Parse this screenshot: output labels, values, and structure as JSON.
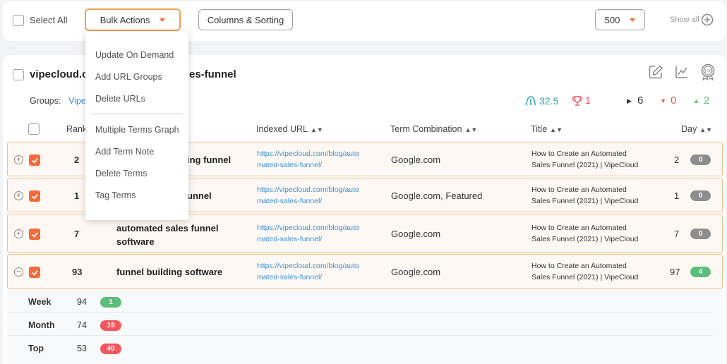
{
  "toolbar": {
    "select_all": "Select All",
    "bulk_actions": "Bulk Actions",
    "columns_sorting": "Columns & Sorting",
    "page_size": "500",
    "show_all": "Show all"
  },
  "menu": {
    "items": [
      "Update On Demand",
      "Add URL Groups",
      "Delete URLs",
      "Multiple Terms Graph",
      "Add Term Note",
      "Delete Terms",
      "Tag Terms"
    ]
  },
  "site": {
    "name_left": "vipecloud.co",
    "name_right": "es-funnel",
    "groups_label": "Groups:",
    "groups_value": "Vipe"
  },
  "stats": {
    "avg": "32.5",
    "trophy": "1",
    "neutral": "6",
    "down": "0",
    "up": "2"
  },
  "headers": {
    "rank": "Rank",
    "indexed_url": "Indexed URL",
    "term_combination": "Term Combination",
    "title": "Title",
    "day": "Day"
  },
  "rows": [
    {
      "rank": "2",
      "term": "ing funnel",
      "url1": "https://vipecloud.com/blog/auto",
      "url2": "mated-sales-funnel/",
      "combo": "Google.com",
      "title1": "How to Create an Automated",
      "title2": "Sales Funnel (2021) | VipeCloud",
      "day": "2",
      "change": "0"
    },
    {
      "rank": "1",
      "term": "unnel",
      "url1": "https://vipecloud.com/blog/auto",
      "url2": "mated-sales-funnel/",
      "combo": "Google.com, Featured",
      "title1": "How to Create an Automated",
      "title2": "Sales Funnel (2021) | VipeCloud",
      "day": "1",
      "change": "0"
    },
    {
      "rank": "7",
      "term1": "automated sales funnel",
      "term2": "software",
      "url1": "https://vipecloud.com/blog/auto",
      "url2": "mated-sales-funnel/",
      "combo": "Google.com",
      "title1": "How to Create an Automated",
      "title2": "Sales Funnel (2021) | VipeCloud",
      "day": "7",
      "change": "0"
    },
    {
      "rank": "93",
      "term": "funnel building software",
      "url1": "https://vipecloud.com/blog/auto",
      "url2": "mated-sales-funnel/",
      "combo": "Google.com",
      "title1": "How to Create an Automated",
      "title2": "Sales Funnel (2021) | VipeCloud",
      "day": "97",
      "change": "4"
    }
  ],
  "history": [
    {
      "label": "Week",
      "value": "94",
      "change": "1"
    },
    {
      "label": "Month",
      "value": "74",
      "change": "19"
    },
    {
      "label": "Top",
      "value": "53",
      "change": "40"
    }
  ],
  "colors": {
    "accent": "#f26b3a",
    "link": "#3a8fd8",
    "green": "#5cbd7c",
    "red": "#f0575e",
    "teal": "#3aa0b8"
  }
}
